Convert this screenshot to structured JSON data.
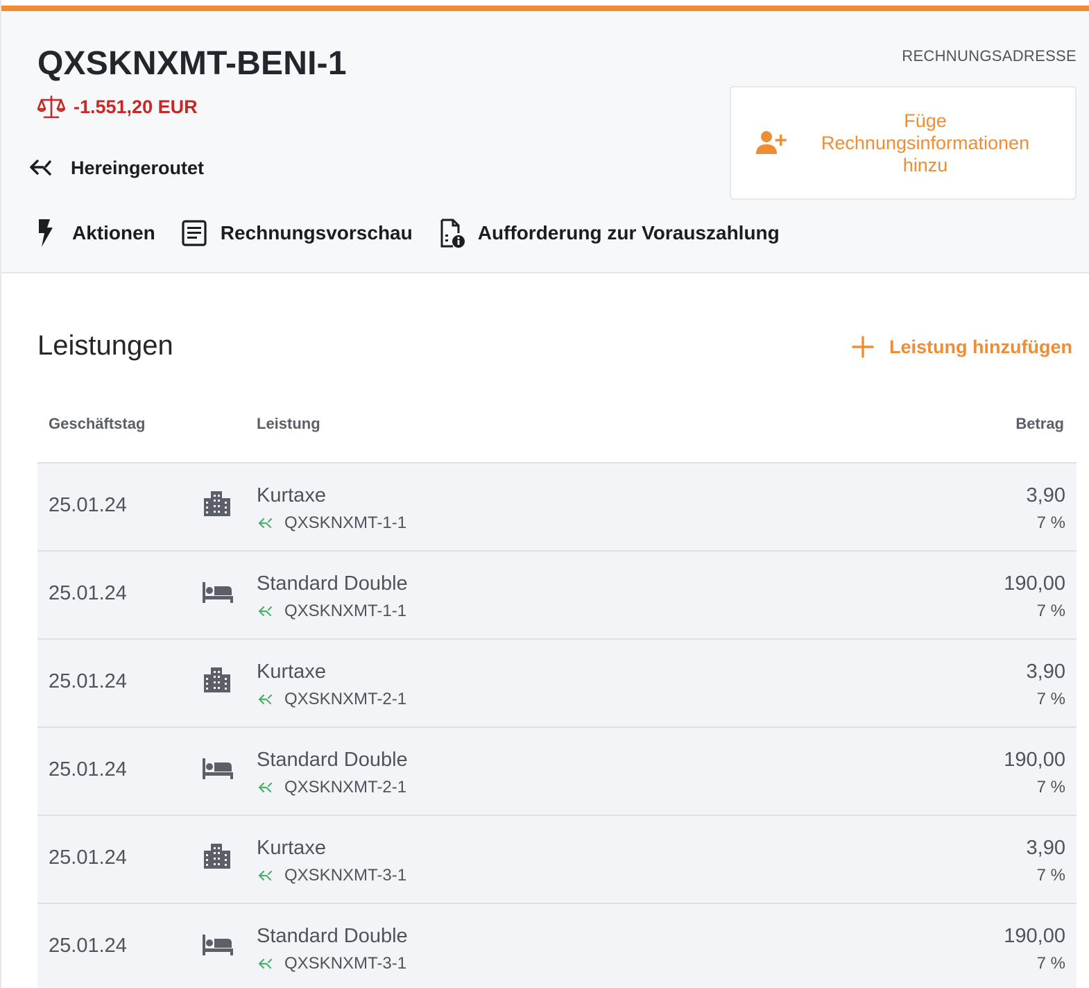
{
  "header": {
    "folio_title": "QXSKNXMT-BENI-1",
    "balance": "-1.551,20 EUR",
    "routed_label": "Hereingeroutet",
    "billing_address_label": "RECHNUNGSADRESSE",
    "add_billing_info": "Füge Rechnungsinformationen hinzu",
    "actions": [
      {
        "label": "Aktionen",
        "icon": "bolt-icon"
      },
      {
        "label": "Rechnungsvorschau",
        "icon": "document-list-icon"
      },
      {
        "label": "Aufforderung zur Vorauszahlung",
        "icon": "document-info-icon"
      }
    ]
  },
  "services": {
    "title": "Leistungen",
    "add_label": "Leistung hinzufügen",
    "columns": {
      "date": "Geschäftstag",
      "service": "Leistung",
      "amount": "Betrag"
    },
    "rows": [
      {
        "date": "25.01.24",
        "icon": "city-icon",
        "name": "Kurtaxe",
        "route": "QXSKNXMT-1-1",
        "amount": "3,90",
        "vat": "7 %"
      },
      {
        "date": "25.01.24",
        "icon": "bed-icon",
        "name": "Standard Double",
        "route": "QXSKNXMT-1-1",
        "amount": "190,00",
        "vat": "7 %"
      },
      {
        "date": "25.01.24",
        "icon": "city-icon",
        "name": "Kurtaxe",
        "route": "QXSKNXMT-2-1",
        "amount": "3,90",
        "vat": "7 %"
      },
      {
        "date": "25.01.24",
        "icon": "bed-icon",
        "name": "Standard Double",
        "route": "QXSKNXMT-2-1",
        "amount": "190,00",
        "vat": "7 %"
      },
      {
        "date": "25.01.24",
        "icon": "city-icon",
        "name": "Kurtaxe",
        "route": "QXSKNXMT-3-1",
        "amount": "3,90",
        "vat": "7 %"
      },
      {
        "date": "25.01.24",
        "icon": "bed-icon",
        "name": "Standard Double",
        "route": "QXSKNXMT-3-1",
        "amount": "190,00",
        "vat": "7 %"
      }
    ]
  },
  "colors": {
    "accent": "#ef8d34",
    "negative": "#c62828",
    "route_icon": "#4caf6a",
    "row_bg": "#f3f4f7",
    "header_bg": "#f7f8fa"
  }
}
